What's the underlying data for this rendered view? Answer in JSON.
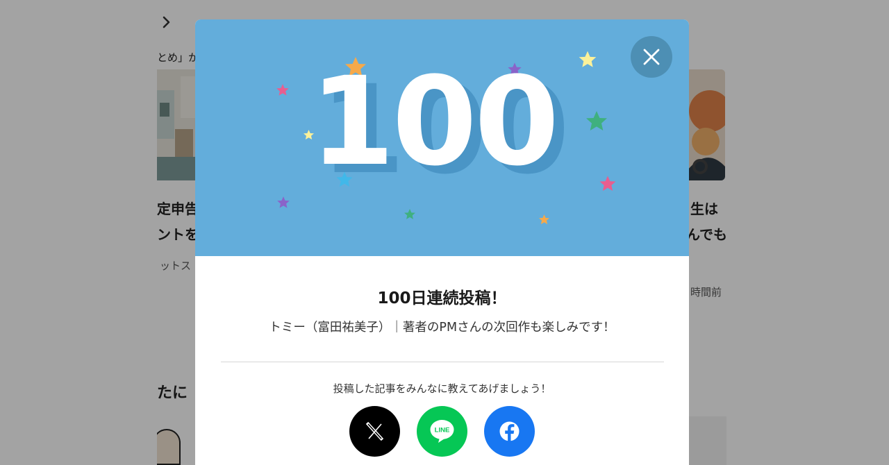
{
  "background": {
    "snippets": [
      "とめ」か",
      "定申告",
      "ントを",
      "ットス",
      "たに",
      "生は",
      "んでも",
      "時間前"
    ]
  },
  "modal": {
    "milestone_number": "100",
    "title": "100日連続投稿！",
    "subtitle": "トミー（富田祐美子）｜著者のPMさんの次回作も楽しみです！",
    "share_prompt": "投稿した記事をみんなに教えてあげましょう！",
    "line_badge_text": "LINE",
    "colors": {
      "hero": "#63addb",
      "x": "#000000",
      "line": "#06c755",
      "facebook": "#1877f2"
    }
  },
  "icons": [
    "close-icon",
    "chevron-right-icon",
    "x-logo-icon",
    "line-logo-icon",
    "facebook-logo-icon",
    "star-icon"
  ]
}
